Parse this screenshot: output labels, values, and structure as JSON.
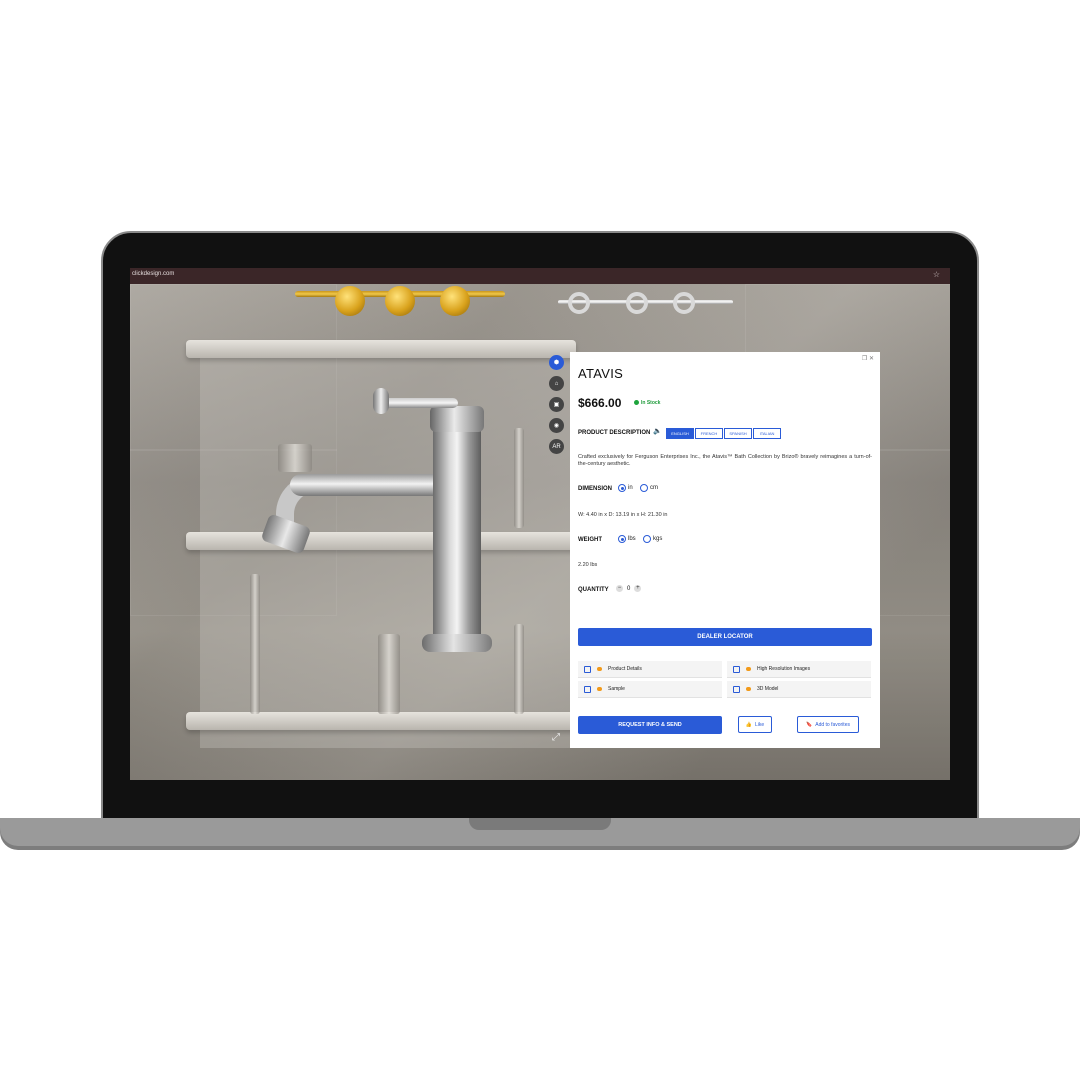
{
  "browser": {
    "url": "clickdesign.com"
  },
  "toolbar": {
    "tools": [
      "cube-icon",
      "hanger-icon",
      "image-icon",
      "camera-icon",
      "AR"
    ]
  },
  "product": {
    "title": "ATAVIS",
    "price": "$666.00",
    "stock": "In Stock",
    "description_label": "PRODUCT DESCRIPTION",
    "languages": [
      "ENGLISH",
      "FRENCH",
      "SPANISH",
      "ITALIAN"
    ],
    "active_language": "ENGLISH",
    "description": "Crafted exclusively for Ferguson Enterprises Inc., the Atavis™ Bath Collection by Brizo® bravely reimagines a turn-of-the-century aesthetic.",
    "dimension_label": "DIMENSION",
    "dimension_units": {
      "in": "in",
      "cm": "cm",
      "selected": "in"
    },
    "dimension_value": "W: 4.40 in x D: 13.19 in x H: 21.30 in",
    "weight_label": "WEIGHT",
    "weight_units": {
      "lbs": "lbs",
      "kgs": "kgs",
      "selected": "lbs"
    },
    "weight_value": "2.20 lbs",
    "quantity_label": "QUANTITY",
    "quantity": "0"
  },
  "actions": {
    "dealer": "DEALER LOCATOR",
    "options": [
      "Product Details",
      "High Resolution Images",
      "Sample",
      "3D Model"
    ],
    "request": "REQUEST INFO & SEND",
    "like": "Like",
    "favorites": "Add to favorites"
  },
  "colors": {
    "accent": "#2a5bd7",
    "stock": "#1e9a3a",
    "browser_bar": "#3b2628"
  }
}
